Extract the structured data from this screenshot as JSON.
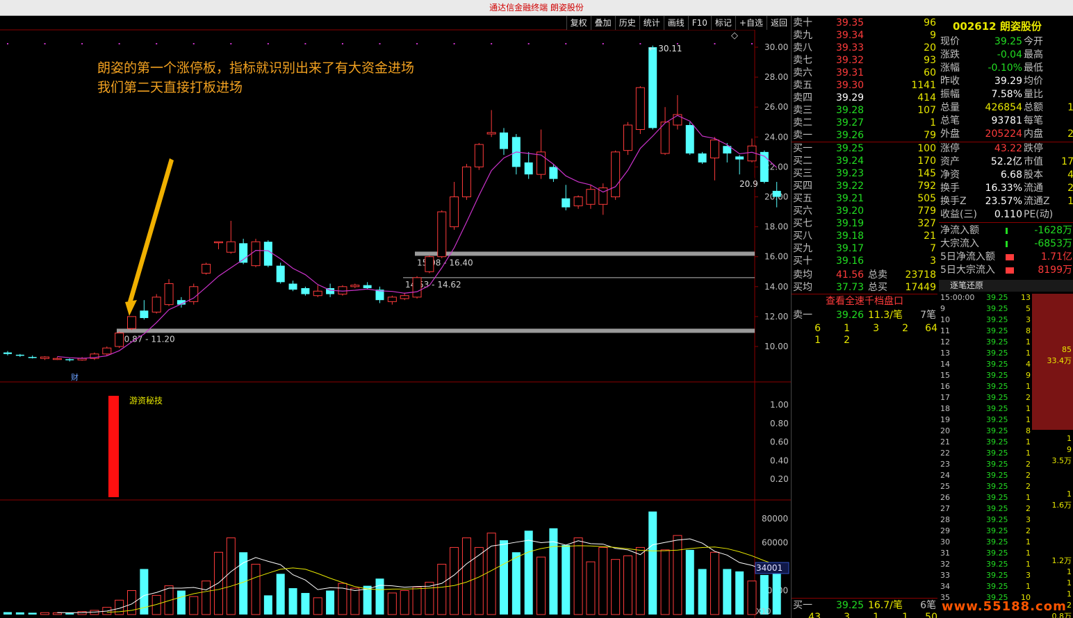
{
  "window": {
    "title": "通达信金融终端  朗姿股份"
  },
  "toolbar": [
    "复权",
    "叠加",
    "历史",
    "统计",
    "画线",
    "F10",
    "标记",
    "+自选",
    "返回"
  ],
  "annotation": {
    "line1": "朗姿的第一个涨停板，指标就识别出来了有大资金进场",
    "line2": "我们第二天直接打板进场"
  },
  "price_axis": [
    "30.00",
    "28.00",
    "26.00",
    "24.00",
    "22.00",
    "20.00",
    "18.00",
    "16.00",
    "14.00",
    "12.00",
    "10.00"
  ],
  "indicator_axis": [
    "1.00",
    "0.80",
    "0.60",
    "0.40",
    "0.20"
  ],
  "volume_axis": [
    "80000",
    "60000",
    "40000",
    "20000"
  ],
  "volume_current": "34001",
  "volume_unit": "X10",
  "indicator_name": "游资秘技",
  "fin_marker": "财",
  "high_label": "30.11",
  "last_label": "20.9",
  "zones": [
    "10.87 - 11.20",
    "14.53 - 14.62",
    "15.98 - 16.40"
  ],
  "chart_data": {
    "type": "candlestick",
    "title": "",
    "ma_color": "#cc33cc",
    "up_color": "#ff3b3b",
    "down_color": "#54ffff",
    "ylim": [
      9.0,
      31.0
    ],
    "candles": [
      {
        "o": 9.6,
        "c": 9.5,
        "h": 9.7,
        "l": 9.4
      },
      {
        "o": 9.45,
        "c": 9.4,
        "h": 9.5,
        "l": 9.3
      },
      {
        "o": 9.3,
        "c": 9.25,
        "h": 9.4,
        "l": 9.2
      },
      {
        "o": 9.2,
        "c": 9.3,
        "h": 9.35,
        "l": 9.1
      },
      {
        "o": 9.2,
        "c": 9.2,
        "h": 9.3,
        "l": 9.1
      },
      {
        "o": 9.15,
        "c": 9.1,
        "h": 9.2,
        "l": 9.0
      },
      {
        "o": 9.1,
        "c": 9.2,
        "h": 9.3,
        "l": 9.05
      },
      {
        "o": 9.2,
        "c": 9.5,
        "h": 9.6,
        "l": 9.1
      },
      {
        "o": 9.5,
        "c": 9.9,
        "h": 10.0,
        "l": 9.4
      },
      {
        "o": 10.0,
        "c": 10.9,
        "h": 11.0,
        "l": 9.9
      },
      {
        "o": 11.2,
        "c": 12.0,
        "h": 12.0,
        "l": 11.1
      },
      {
        "o": 12.4,
        "c": 11.9,
        "h": 13.1,
        "l": 11.8
      },
      {
        "o": 12.3,
        "c": 13.3,
        "h": 13.5,
        "l": 12.2
      },
      {
        "o": 12.8,
        "c": 14.2,
        "h": 14.5,
        "l": 12.7
      },
      {
        "o": 13.1,
        "c": 12.8,
        "h": 13.3,
        "l": 12.6
      },
      {
        "o": 13.0,
        "c": 14.0,
        "h": 14.2,
        "l": 12.8
      },
      {
        "o": 14.9,
        "c": 15.5,
        "h": 15.6,
        "l": 14.8
      },
      {
        "o": 17.0,
        "c": 17.0,
        "h": 17.0,
        "l": 16.5
      },
      {
        "o": 16.3,
        "c": 17.0,
        "h": 18.4,
        "l": 16.2
      },
      {
        "o": 16.9,
        "c": 15.6,
        "h": 17.2,
        "l": 15.5
      },
      {
        "o": 15.4,
        "c": 17.0,
        "h": 17.2,
        "l": 15.3
      },
      {
        "o": 17.0,
        "c": 15.4,
        "h": 17.1,
        "l": 15.3
      },
      {
        "o": 15.4,
        "c": 14.3,
        "h": 15.6,
        "l": 14.2
      },
      {
        "o": 14.2,
        "c": 13.8,
        "h": 14.4,
        "l": 13.7
      },
      {
        "o": 13.9,
        "c": 13.5,
        "h": 14.0,
        "l": 13.4
      },
      {
        "o": 13.4,
        "c": 13.7,
        "h": 14.1,
        "l": 13.3
      },
      {
        "o": 13.9,
        "c": 13.5,
        "h": 14.2,
        "l": 13.3
      },
      {
        "o": 13.5,
        "c": 14.0,
        "h": 14.1,
        "l": 13.4
      },
      {
        "o": 14.0,
        "c": 14.1,
        "h": 14.2,
        "l": 13.9
      },
      {
        "o": 14.1,
        "c": 13.9,
        "h": 14.3,
        "l": 13.8
      },
      {
        "o": 13.8,
        "c": 13.1,
        "h": 14.0,
        "l": 12.9
      },
      {
        "o": 13.0,
        "c": 13.3,
        "h": 13.4,
        "l": 12.8
      },
      {
        "o": 13.2,
        "c": 13.4,
        "h": 13.6,
        "l": 13.1
      },
      {
        "o": 13.3,
        "c": 14.6,
        "h": 14.7,
        "l": 13.2
      },
      {
        "o": 15.0,
        "c": 16.0,
        "h": 16.1,
        "l": 14.9
      },
      {
        "o": 16.0,
        "c": 19.0,
        "h": 19.1,
        "l": 15.9
      },
      {
        "o": 18.0,
        "c": 20.0,
        "h": 21.0,
        "l": 17.8
      },
      {
        "o": 20.0,
        "c": 22.0,
        "h": 22.2,
        "l": 19.8
      },
      {
        "o": 22.0,
        "c": 23.5,
        "h": 23.6,
        "l": 21.8
      },
      {
        "o": 24.2,
        "c": 24.3,
        "h": 25.8,
        "l": 24.0
      },
      {
        "o": 24.3,
        "c": 23.2,
        "h": 24.6,
        "l": 22.8
      },
      {
        "o": 24.0,
        "c": 22.0,
        "h": 24.2,
        "l": 21.5
      },
      {
        "o": 22.3,
        "c": 21.5,
        "h": 23.0,
        "l": 21.2
      },
      {
        "o": 21.5,
        "c": 23.0,
        "h": 24.5,
        "l": 21.2
      },
      {
        "o": 22.0,
        "c": 21.2,
        "h": 22.2,
        "l": 21.0
      },
      {
        "o": 19.9,
        "c": 19.3,
        "h": 20.8,
        "l": 19.1
      },
      {
        "o": 19.4,
        "c": 20.0,
        "h": 20.1,
        "l": 19.2
      },
      {
        "o": 19.5,
        "c": 20.5,
        "h": 20.8,
        "l": 19.2
      },
      {
        "o": 19.5,
        "c": 20.6,
        "h": 20.9,
        "l": 18.8
      },
      {
        "o": 20.0,
        "c": 23.0,
        "h": 23.1,
        "l": 19.8
      },
      {
        "o": 23.1,
        "c": 24.8,
        "h": 25.0,
        "l": 22.8
      },
      {
        "o": 24.5,
        "c": 27.3,
        "h": 27.4,
        "l": 24.2
      },
      {
        "o": 30.0,
        "c": 24.6,
        "h": 30.11,
        "l": 24.5
      },
      {
        "o": 22.9,
        "c": 25.0,
        "h": 26.0,
        "l": 22.8
      },
      {
        "o": 24.8,
        "c": 25.5,
        "h": 26.8,
        "l": 24.5
      },
      {
        "o": 24.8,
        "c": 22.9,
        "h": 25.0,
        "l": 22.8
      },
      {
        "o": 22.9,
        "c": 22.3,
        "h": 23.0,
        "l": 22.2
      },
      {
        "o": 22.6,
        "c": 23.8,
        "h": 24.0,
        "l": 21.1
      },
      {
        "o": 23.4,
        "c": 22.9,
        "h": 23.6,
        "l": 22.3
      },
      {
        "o": 22.7,
        "c": 22.5,
        "h": 22.8,
        "l": 21.5
      },
      {
        "o": 22.4,
        "c": 23.4,
        "h": 23.9,
        "l": 22.3
      },
      {
        "o": 23.0,
        "c": 21.0,
        "h": 23.1,
        "l": 20.9
      },
      {
        "o": 20.4,
        "c": 20.0,
        "h": 21.0,
        "l": 19.3
      }
    ],
    "volumes": [
      2000,
      1800,
      1500,
      1600,
      1400,
      1300,
      2500,
      3500,
      6000,
      12000,
      20000,
      38000,
      16000,
      24000,
      20000,
      15000,
      28000,
      52000,
      64000,
      52000,
      42000,
      16000,
      34000,
      22000,
      18000,
      14000,
      20000,
      26000,
      22000,
      24000,
      30000,
      18000,
      20000,
      23000,
      27000,
      42000,
      56000,
      64000,
      56000,
      68000,
      62000,
      52000,
      70000,
      48000,
      72000,
      58000,
      64000,
      44000,
      56000,
      46000,
      49000,
      56000,
      86000,
      54000,
      66000,
      54000,
      38000,
      52000,
      38000,
      36000,
      28000,
      33000,
      34001
    ],
    "ma_volumes": [
      null,
      null,
      null,
      null,
      1660,
      1520,
      1660,
      2060,
      2920,
      5140,
      8800,
      15900,
      18400,
      22000,
      22000,
      22600,
      20600,
      26400,
      35800,
      43200,
      47600,
      44400,
      41600,
      33200,
      28800,
      20800,
      22400,
      22000,
      20000,
      21200,
      24400,
      24000,
      22800,
      23400,
      23600,
      26000,
      33000,
      42400,
      49600,
      57200,
      58600,
      60400,
      62000,
      60000,
      60800,
      58000,
      61600,
      59200,
      58800,
      55200,
      54000,
      50000,
      58200,
      60200,
      62200,
      63200,
      59600,
      52800,
      49600,
      43400,
      41000,
      37400,
      36800
    ]
  },
  "orderbook": {
    "sells": [
      {
        "label": "卖十",
        "price": "39.35",
        "vol": "96",
        "color": "red"
      },
      {
        "label": "卖九",
        "price": "39.34",
        "vol": "9",
        "color": "red"
      },
      {
        "label": "卖八",
        "price": "39.33",
        "vol": "20",
        "color": "red"
      },
      {
        "label": "卖七",
        "price": "39.32",
        "vol": "93",
        "color": "red"
      },
      {
        "label": "卖六",
        "price": "39.31",
        "vol": "60",
        "color": "red"
      },
      {
        "label": "卖五",
        "price": "39.30",
        "vol": "1141",
        "color": "red"
      },
      {
        "label": "卖四",
        "price": "39.29",
        "vol": "414",
        "color": "wht"
      },
      {
        "label": "卖三",
        "price": "39.28",
        "vol": "107",
        "color": "grn"
      },
      {
        "label": "卖二",
        "price": "39.27",
        "vol": "1",
        "color": "grn"
      },
      {
        "label": "卖一",
        "price": "39.26",
        "vol": "79",
        "color": "grn"
      }
    ],
    "buys": [
      {
        "label": "买一",
        "price": "39.25",
        "vol": "100",
        "color": "grn"
      },
      {
        "label": "买二",
        "price": "39.24",
        "vol": "170",
        "color": "grn"
      },
      {
        "label": "买三",
        "price": "39.23",
        "vol": "145",
        "color": "grn"
      },
      {
        "label": "买四",
        "price": "39.22",
        "vol": "792",
        "color": "grn"
      },
      {
        "label": "买五",
        "price": "39.21",
        "vol": "505",
        "color": "grn"
      },
      {
        "label": "买六",
        "price": "39.20",
        "vol": "779",
        "color": "grn"
      },
      {
        "label": "买七",
        "price": "39.19",
        "vol": "327",
        "color": "grn"
      },
      {
        "label": "买八",
        "price": "39.18",
        "vol": "21",
        "color": "grn"
      },
      {
        "label": "买九",
        "price": "39.17",
        "vol": "7",
        "color": "grn"
      },
      {
        "label": "买十",
        "price": "39.16",
        "vol": "3",
        "color": "grn"
      }
    ],
    "avg_sell_label": "卖均",
    "avg_sell": "41.56",
    "total_sell_label": "总卖",
    "total_sell": "23718",
    "avg_buy_label": "买均",
    "avg_buy": "37.73",
    "total_buy_label": "总买",
    "total_buy": "17449",
    "view_full": "查看全速千档盘口",
    "q1_label": "卖一",
    "q1_price": "39.26",
    "q1_avg": "11.3/笔",
    "q1_count": "7笔",
    "q1_row1": [
      "6",
      "1",
      "3",
      "2",
      "64"
    ],
    "q1_row2": [
      "1",
      "2"
    ],
    "b1_label": "买一",
    "b1_price": "39.25",
    "b1_avg": "16.7/笔",
    "b1_count": "6笔",
    "b1_row1": [
      "43",
      "3",
      "1",
      "1",
      "50"
    ]
  },
  "quote": {
    "code": "002612 朗姿股份",
    "rows": [
      {
        "k": "现价",
        "v": "39.25",
        "vc": "grn",
        "k2": "今开",
        "v2": ""
      },
      {
        "k": "涨跌",
        "v": "-0.04",
        "vc": "grn",
        "k2": "最高",
        "v2": ""
      },
      {
        "k": "涨幅",
        "v": "-0.10%",
        "vc": "grn",
        "k2": "最低",
        "v2": ""
      },
      {
        "k": "昨收",
        "v": "39.29",
        "vc": "wht",
        "k2": "均价",
        "v2": ""
      },
      {
        "k": "振幅",
        "v": "7.58%",
        "vc": "wht",
        "k2": "量比",
        "v2": ""
      },
      {
        "k": "总量",
        "v": "426854",
        "vc": "yel",
        "k2": "总额",
        "v2": "1"
      },
      {
        "k": "总笔",
        "v": "93781",
        "vc": "wht",
        "k2": "每笔",
        "v2": ""
      },
      {
        "k": "外盘",
        "v": "205224",
        "vc": "red",
        "k2": "内盘",
        "v2": "2"
      }
    ],
    "rows2": [
      {
        "k": "涨停",
        "v": "43.22",
        "vc": "red",
        "k2": "跌停",
        "v2": ""
      },
      {
        "k": "资产",
        "v": "52.2亿",
        "vc": "wht",
        "k2": "市值",
        "v2": "17"
      },
      {
        "k": "净资",
        "v": "6.68",
        "vc": "wht",
        "k2": "股本",
        "v2": "4"
      },
      {
        "k": "换手",
        "v": "16.33%",
        "vc": "wht",
        "k2": "流通",
        "v2": "2"
      },
      {
        "k": "换手Z",
        "v": "23.57%",
        "vc": "wht",
        "k2": "流通Z",
        "v2": "1"
      },
      {
        "k": "收益(三)",
        "v": "0.110",
        "vc": "wht",
        "k2": "PE(动)",
        "v2": ""
      }
    ],
    "flows": [
      {
        "k": "净流入额",
        "v": "-1628万",
        "vc": "grn"
      },
      {
        "k": "大宗流入",
        "v": "-6853万",
        "vc": "grn"
      },
      {
        "k": "5日净流入额",
        "v": "1.71亿",
        "vc": "red"
      },
      {
        "k": "5日大宗流入",
        "v": "8199万",
        "vc": "red"
      }
    ]
  },
  "ticks": {
    "header": "逐笔还原",
    "rows": [
      {
        "t": "15:00:00",
        "p": "39.25",
        "q": "13"
      },
      {
        "t": "9",
        "p": "39.25",
        "q": "5"
      },
      {
        "t": "10",
        "p": "39.25",
        "q": "3"
      },
      {
        "t": "11",
        "p": "39.25",
        "q": "8"
      },
      {
        "t": "12",
        "p": "39.25",
        "q": "1"
      },
      {
        "t": "13",
        "p": "39.25",
        "q": "1"
      },
      {
        "t": "14",
        "p": "39.25",
        "q": "4"
      },
      {
        "t": "15",
        "p": "39.25",
        "q": "9"
      },
      {
        "t": "16",
        "p": "39.25",
        "q": "1"
      },
      {
        "t": "17",
        "p": "39.25",
        "q": "2"
      },
      {
        "t": "18",
        "p": "39.25",
        "q": "1"
      },
      {
        "t": "19",
        "p": "39.25",
        "q": "1"
      },
      {
        "t": "20",
        "p": "39.25",
        "q": "8"
      },
      {
        "t": "21",
        "p": "39.25",
        "q": "1"
      },
      {
        "t": "22",
        "p": "39.25",
        "q": "1"
      },
      {
        "t": "23",
        "p": "39.25",
        "q": "2"
      },
      {
        "t": "24",
        "p": "39.25",
        "q": "2"
      },
      {
        "t": "25",
        "p": "39.25",
        "q": "2"
      },
      {
        "t": "26",
        "p": "39.25",
        "q": "1"
      },
      {
        "t": "27",
        "p": "39.25",
        "q": "2"
      },
      {
        "t": "28",
        "p": "39.25",
        "q": "3"
      },
      {
        "t": "29",
        "p": "39.25",
        "q": "2"
      },
      {
        "t": "30",
        "p": "39.25",
        "q": "1"
      },
      {
        "t": "31",
        "p": "39.25",
        "q": "1"
      },
      {
        "t": "32",
        "p": "39.25",
        "q": "1"
      },
      {
        "t": "33",
        "p": "39.25",
        "q": "3"
      },
      {
        "t": "34",
        "p": "39.25",
        "q": "1"
      },
      {
        "t": "35",
        "p": "39.25",
        "q": "10"
      }
    ],
    "side": [
      "85",
      "33.4万",
      "1",
      "9",
      "3.5万",
      "1",
      "1.6万",
      "1.2万",
      "1",
      "1",
      "1",
      "2",
      "0.8万",
      "2"
    ]
  },
  "watermark": "www.55188.com"
}
